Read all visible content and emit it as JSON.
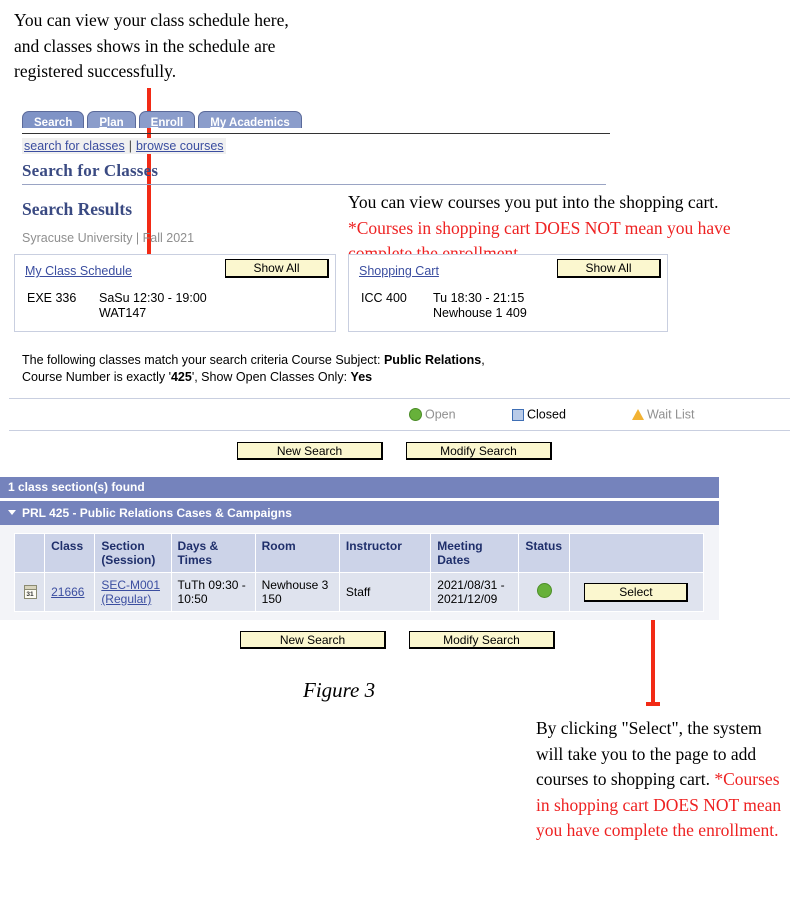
{
  "annotations": {
    "top_left": {
      "lines": [
        "You can view your class schedule here,",
        "and classes shows in the schedule are",
        "registered successfully."
      ]
    },
    "top_right": {
      "black_part": "You can view courses you put into the shopping cart. ",
      "red_part": "*Courses in shopping cart DOES NOT mean you have complete the enrollment."
    },
    "bottom_right": {
      "black_part": "By  clicking \"Select\", the system will take you to the page to add courses to shopping cart. ",
      "red_part": "*Courses in shopping cart DOES NOT mean you have complete the enrollment."
    },
    "figure_caption": "Figure 3"
  },
  "app": {
    "tabs": [
      {
        "label": "Search",
        "accesskey": "",
        "active": true
      },
      {
        "label": "Plan",
        "accesskey": "P",
        "active": false
      },
      {
        "label": "Enroll",
        "accesskey": "E",
        "active": false
      },
      {
        "label": "My Academics",
        "accesskey": "M",
        "active": false
      }
    ],
    "breadcrumbs": {
      "first": "search for classes",
      "separator": "|",
      "second": "browse courses"
    },
    "page_title": "Search for Classes",
    "results_title": "Search Results",
    "term_line": "Syracuse University | Fall 2021",
    "panels": {
      "schedule": {
        "link": "My Class Schedule",
        "show_all_label": "Show All",
        "rows": [
          {
            "code": "EXE 336",
            "line1": "SaSu 12:30 - 19:00",
            "line2": "WAT147"
          }
        ]
      },
      "cart": {
        "link": "Shopping Cart",
        "show_all_label": "Show All",
        "rows": [
          {
            "code": "ICC 400",
            "line1": "Tu 18:30 - 21:15",
            "line2": "Newhouse 1 409"
          }
        ]
      }
    },
    "criteria": {
      "prefix": "The following classes match your search criteria Course Subject: ",
      "subject": "Public Relations",
      "mid1": ",  Course Number is exactly '",
      "number": "425",
      "mid2": "',  Show Open Classes Only: ",
      "open_only": "Yes"
    },
    "legend": [
      {
        "label": "Open",
        "symbol": "green-circle-icon",
        "color": "#67b13a"
      },
      {
        "label": "Closed",
        "symbol": "blue-square-icon",
        "color": "#b9cbe8"
      },
      {
        "label": "Wait List",
        "symbol": "yellow-triangle-icon",
        "color": "#f2b233"
      }
    ],
    "buttons": {
      "new_search": "New Search",
      "modify_search": "Modify Search"
    },
    "results": {
      "count_bar": "1 class section(s) found",
      "course_bar": "PRL 425 - Public Relations Cases & Campaigns",
      "columns": [
        "",
        "Class",
        "Section (Session)",
        "Days & Times",
        "Room",
        "Instructor",
        "Meeting Dates",
        "Status",
        ""
      ],
      "columns_split": {
        "section_l1": "Section",
        "section_l2": "(Session)",
        "meeting_l1": "Meeting",
        "meeting_l2": "Dates"
      },
      "rows": [
        {
          "icon": "calendar-icon",
          "icon_text": "31",
          "class_nbr": "21666",
          "section_l1": "SEC-M001",
          "section_l2": "(Regular)",
          "days_l1": "TuTh 09:30 -",
          "days_l2": "10:50",
          "room_l1": "Newhouse 3",
          "room_l2": "150",
          "instructor": "Staff",
          "meeting_l1": "2021/08/31 -",
          "meeting_l2": "2021/12/09",
          "status": "open",
          "select_label": "Select"
        }
      ]
    }
  }
}
